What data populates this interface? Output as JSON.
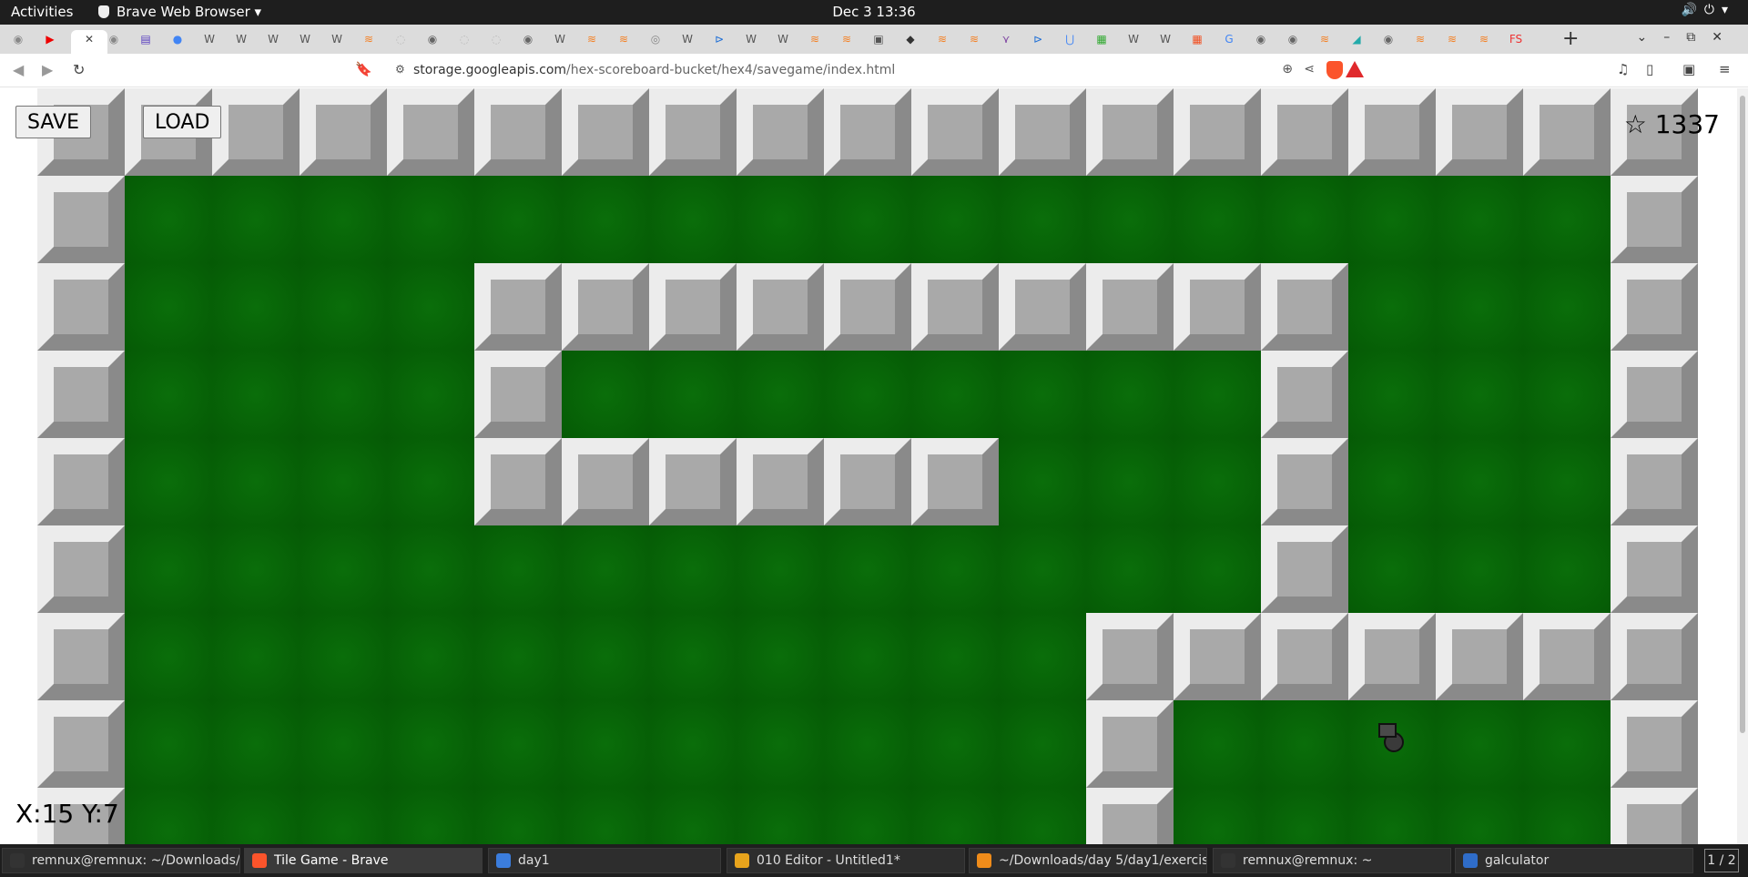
{
  "topbar": {
    "activities": "Activities",
    "app_menu": "Brave Web Browser",
    "clock": "Dec 3  13:36"
  },
  "browser": {
    "url_host": "storage.googleapis.com",
    "url_path": "/hex-scoreboard-bucket/hex4/savegame/index.html",
    "tab_count_icons": 48
  },
  "game": {
    "save_label": "SAVE",
    "load_label": "LOAD",
    "score": "☆ 1337",
    "coords": "X:15 Y:7",
    "grid": [
      "WWWWWWWWWWWWWWWWWWW",
      "WGGGGGGGGGGGGGGGGGW",
      "WGGGGWWWWWWWWWWGGGW",
      "WGGGGWGGGGGGGGWGGGW",
      "WGGGGWWWWWWGGGWGGGW",
      "WGGGGGGGGGGGGGWGGGW",
      "WGGGGGGGGGGGWWWWWWW",
      "WGGGGGGGGGGGWGGGGGW",
      "WGGGGGGGGGGGWGGGGGW"
    ]
  },
  "taskbar": {
    "items": [
      {
        "label": "remnux@remnux: ~/Downloads/d...",
        "icon": "terminal-icon"
      },
      {
        "label": "Tile Game - Brave",
        "icon": "brave-icon"
      },
      {
        "label": "day1",
        "icon": "file-manager-icon"
      },
      {
        "label": "010 Editor - Untitled1*",
        "icon": "010-editor-icon"
      },
      {
        "label": "~/Downloads/day 5/day1/exercise ...",
        "icon": "sublime-icon"
      },
      {
        "label": "remnux@remnux: ~",
        "icon": "terminal-icon"
      },
      {
        "label": "galculator",
        "icon": "calculator-icon"
      }
    ],
    "pager": "1 / 2"
  }
}
